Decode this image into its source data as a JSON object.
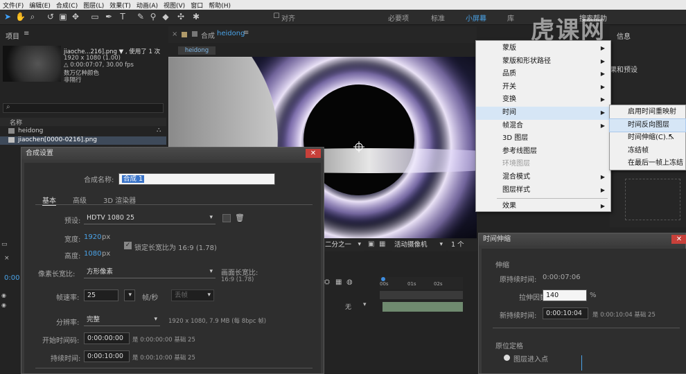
{
  "menubar": [
    "文件(F)",
    "编辑(E)",
    "合成(C)",
    "图层(L)",
    "效果(T)",
    "动画(A)",
    "视图(V)",
    "窗口",
    "帮助(H)"
  ],
  "toolbar": {
    "snap_label": "对齐",
    "workspaces": [
      "必要项",
      "标准",
      "小屏幕",
      "库",
      "搜索帮助"
    ]
  },
  "project": {
    "title": "项目",
    "file_name": "jiaoche...216].png ▼ , 使用了 1 次",
    "file_dims": "1920 x 1080 (1.00)",
    "file_duration": "△ 0:00:07:07, 30.00 fps",
    "file_colors": "数万亿种颜色",
    "file_interlace": "非隔行",
    "search_icon": "search-icon",
    "col_name": "名称",
    "items": [
      "heidong",
      "jiaochen[0000-0216].png"
    ]
  },
  "comp_panel": {
    "tab_label": "合成",
    "tab_name": "heidong",
    "chip": "heidong",
    "zoom_select": "二分之一",
    "camera_select": "活动摄像机",
    "view_select": "1 个"
  },
  "timeline": {
    "time_code": "0:00",
    "ruler": [
      "00s",
      "01s",
      "02s"
    ],
    "mode_value": "无"
  },
  "context_menu": {
    "items": [
      {
        "label": "蒙版",
        "arrow": true,
        "disabled": false
      },
      {
        "label": "蒙版和形状路径",
        "arrow": true,
        "disabled": false
      },
      {
        "label": "品质",
        "arrow": true,
        "disabled": false
      },
      {
        "label": "开关",
        "arrow": true,
        "disabled": false
      },
      {
        "label": "变换",
        "arrow": true,
        "disabled": false
      },
      {
        "label": "时间",
        "arrow": true,
        "disabled": false,
        "highlight": true
      },
      {
        "label": "帧混合",
        "arrow": true,
        "disabled": false
      },
      {
        "label": "3D 图层",
        "arrow": false,
        "disabled": false
      },
      {
        "label": "参考线图层",
        "arrow": false,
        "disabled": false
      },
      {
        "label": "环境图层",
        "arrow": false,
        "disabled": true
      },
      {
        "label": "混合模式",
        "arrow": true,
        "disabled": false
      },
      {
        "label": "图层样式",
        "arrow": true,
        "disabled": false
      },
      {
        "label": "效果",
        "arrow": true,
        "disabled": false
      }
    ],
    "submenu": [
      {
        "label": "启用时间重映射"
      },
      {
        "label": "时间反向图层",
        "highlight": true
      },
      {
        "label": "时间伸缩(C)..."
      },
      {
        "label": "冻结帧"
      },
      {
        "label": "在最后一帧上冻结"
      }
    ]
  },
  "right_panel": {
    "effects_presets": "果和预设",
    "info_partial": "信息"
  },
  "comp_settings": {
    "title": "合成设置",
    "name_label": "合成名称:",
    "name_value": "合成 1",
    "tabs": [
      "基本",
      "高级",
      "3D 渲染器"
    ],
    "preset_label": "预设:",
    "preset_value": "HDTV 1080 25",
    "width_label": "宽度:",
    "width_value": "1920",
    "width_unit": "px",
    "height_label": "高度:",
    "height_value": "1080",
    "height_unit": "px",
    "lock_label": "锁定长宽比为 16:9 (1.78)",
    "pixel_aspect_label": "像素长宽比:",
    "pixel_aspect_value": "方形像素",
    "frame_aspect_label": "画面长宽比:",
    "frame_aspect_value": "16:9 (1.78)",
    "fps_label": "帧速率:",
    "fps_value": "25",
    "fps_unit": "帧/秒",
    "drop_frame": "丢帧",
    "resolution_label": "分辨率:",
    "resolution_value": "完整",
    "resolution_note": "1920 x 1080, 7.9 MB (每 8bpc 帧)",
    "start_label": "开始时间码:",
    "start_value": "0:00:00:00",
    "start_note": "是 0:00:00:00   基础 25",
    "duration_label": "持续时间:",
    "duration_value": "0:00:10:00",
    "duration_note": "是 0:00:10:00   基础 25"
  },
  "time_stretch": {
    "title": "时间伸缩",
    "section_stretch": "伸缩",
    "orig_label": "原持续时间:",
    "orig_value": "0:00:07:06",
    "factor_label": "拉伸因数:",
    "factor_value": "140",
    "factor_unit": "%",
    "new_label": "新持续时间:",
    "new_value": "0:00:10:04",
    "new_note": "是 0:00:10:04   基础 25",
    "section_hold": "原位定格",
    "hold_option": "图层进入点"
  },
  "watermark": "虎课网"
}
